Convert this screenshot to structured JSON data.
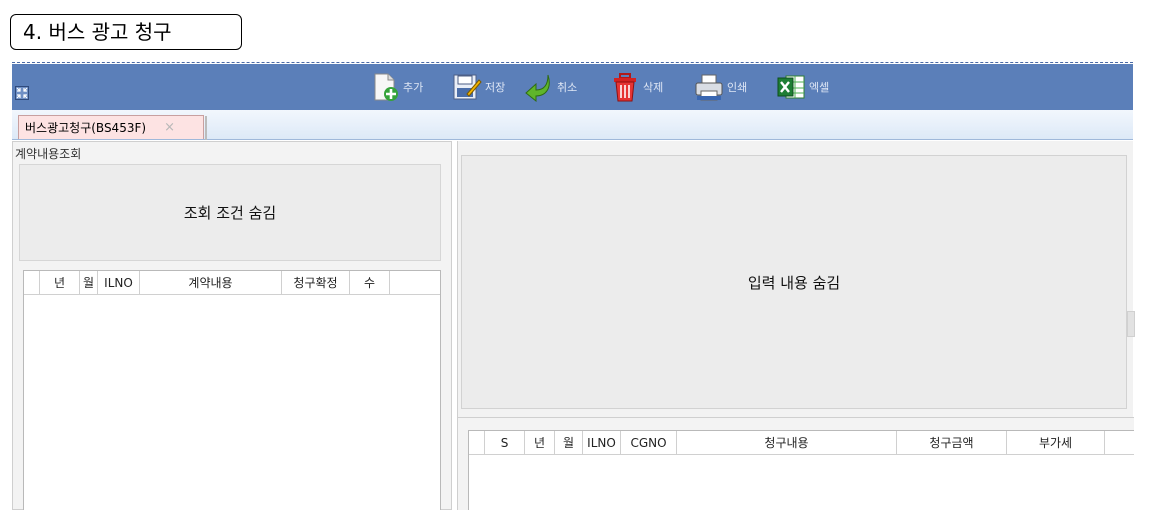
{
  "heading": "4. 버스 광고 청구",
  "toolbar": {
    "buttons": [
      {
        "key": "add",
        "label": "추가",
        "icon": "add-document-icon"
      },
      {
        "key": "save",
        "label": "저장",
        "icon": "save-icon"
      },
      {
        "key": "cancel",
        "label": "취소",
        "icon": "undo-arrow-icon"
      },
      {
        "key": "delete",
        "label": "삭제",
        "icon": "trash-icon"
      },
      {
        "key": "print",
        "label": "인쇄",
        "icon": "printer-icon"
      },
      {
        "key": "excel",
        "label": "엑셀",
        "icon": "excel-icon"
      }
    ]
  },
  "tab": {
    "label": "버스광고청구(BS453F)",
    "close": "×"
  },
  "left_panel": {
    "title": "계약내용조회",
    "hide_conditions": "조회 조건 숨김",
    "grid_headers": [
      "",
      "년",
      "월",
      "ILNO",
      "계약내용",
      "청구확정",
      "수"
    ]
  },
  "right_panel": {
    "hide_input": "입력 내용 숨김",
    "grid_headers": [
      "",
      "S",
      "년",
      "월",
      "ILNO",
      "CGNO",
      "청구내용",
      "청구금액",
      "부가세"
    ]
  },
  "colors": {
    "toolbar_bg": "#5b7fb9",
    "tab_bg": "#fde3e3",
    "panel_bg": "#f3f3f3"
  }
}
